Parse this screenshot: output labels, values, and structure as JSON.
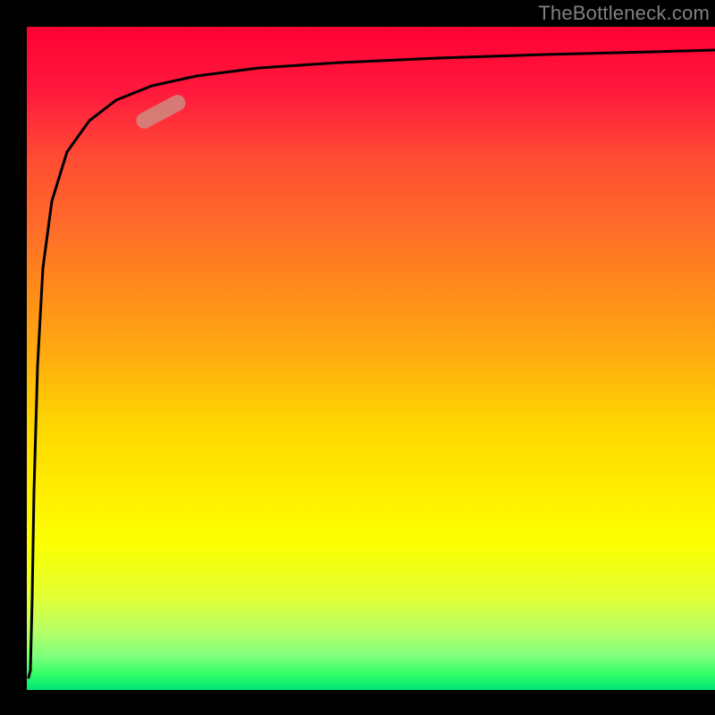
{
  "watermark": "TheBottleneck.com",
  "chart_data": {
    "type": "line",
    "title": "",
    "xlabel": "",
    "ylabel": "",
    "xlim": [
      0,
      100
    ],
    "ylim": [
      0,
      100
    ],
    "grid": false,
    "legend": false,
    "series": [
      {
        "name": "bottleneck-curve",
        "x": [
          0.5,
          0.8,
          1.2,
          2,
          3,
          5,
          8,
          12,
          18,
          25,
          35,
          50,
          65,
          80,
          100
        ],
        "y": [
          2,
          30,
          55,
          72,
          80,
          85,
          88,
          90,
          91.5,
          92.5,
          93.3,
          94,
          94.5,
          94.8,
          95.2
        ]
      }
    ],
    "marker": {
      "x": 18,
      "y": 88,
      "color": "#d08a80"
    },
    "gradient_stops": [
      {
        "pos": 0,
        "color": "#ff0033"
      },
      {
        "pos": 50,
        "color": "#ffd600"
      },
      {
        "pos": 80,
        "color": "#fbff00"
      },
      {
        "pos": 100,
        "color": "#00e676"
      }
    ]
  }
}
